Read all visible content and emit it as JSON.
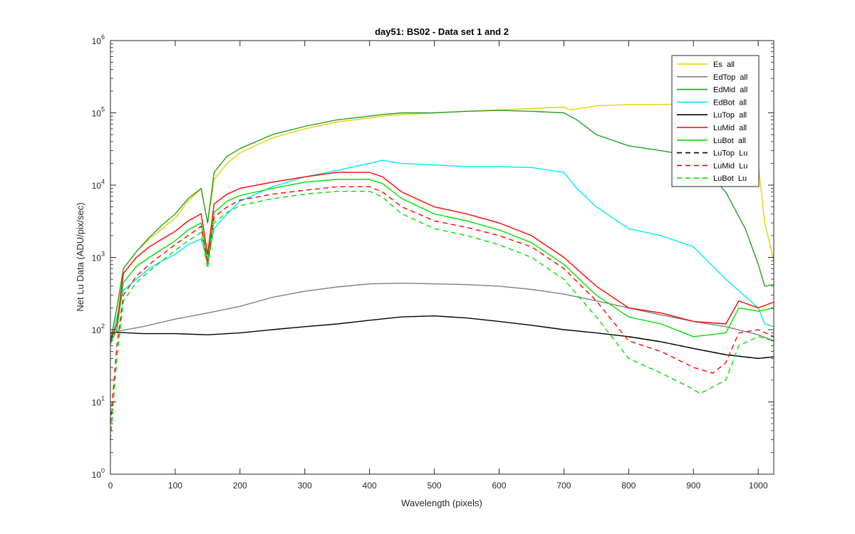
{
  "chart_data": {
    "type": "line",
    "title": "day51: BS02 - Data set 1 and 2",
    "xlabel": "Wavelength (pixels)",
    "ylabel": "Net Lu Data (ADU/pix/sec)",
    "xlim": [
      0,
      1024
    ],
    "ylim": [
      1,
      1000000
    ],
    "yscale": "log",
    "grid": false,
    "legend_position": "top-right",
    "x_ticks": [
      0,
      100,
      200,
      300,
      400,
      500,
      600,
      700,
      800,
      900,
      1000
    ],
    "y_ticks": [
      {
        "base": "10",
        "exp": "0",
        "value": 1
      },
      {
        "base": "10",
        "exp": "1",
        "value": 10
      },
      {
        "base": "10",
        "exp": "2",
        "value": 100
      },
      {
        "base": "10",
        "exp": "3",
        "value": 1000
      },
      {
        "base": "10",
        "exp": "4",
        "value": 10000
      },
      {
        "base": "10",
        "exp": "5",
        "value": 100000
      },
      {
        "base": "10",
        "exp": "6",
        "value": 1000000
      }
    ],
    "series": [
      {
        "name": "Es  all",
        "color": "#e6d000",
        "dash": "solid",
        "x": [
          0,
          10,
          20,
          40,
          60,
          80,
          100,
          120,
          140,
          150,
          160,
          180,
          200,
          250,
          300,
          350,
          400,
          420,
          450,
          500,
          550,
          600,
          650,
          700,
          710,
          750,
          800,
          850,
          900,
          950,
          980,
          1000,
          1010,
          1024
        ],
        "y": [
          70,
          200,
          700,
          1200,
          1800,
          2500,
          3500,
          6000,
          9000,
          3000,
          12000,
          20000,
          28000,
          45000,
          60000,
          75000,
          85000,
          90000,
          95000,
          100000,
          105000,
          110000,
          115000,
          120000,
          110000,
          125000,
          130000,
          130000,
          135000,
          130000,
          100000,
          20000,
          3000,
          900
        ]
      },
      {
        "name": "EdTop  all",
        "color": "#808080",
        "dash": "solid",
        "x": [
          0,
          10,
          50,
          100,
          150,
          200,
          250,
          300,
          350,
          400,
          450,
          500,
          550,
          600,
          650,
          700,
          750,
          800,
          850,
          900,
          950,
          1000,
          1024
        ],
        "y": [
          80,
          95,
          110,
          140,
          170,
          210,
          280,
          340,
          390,
          430,
          440,
          430,
          420,
          400,
          360,
          310,
          250,
          200,
          160,
          130,
          110,
          85,
          70
        ]
      },
      {
        "name": "EdMid  all",
        "color": "#20a020",
        "dash": "solid",
        "x": [
          0,
          10,
          20,
          40,
          60,
          80,
          100,
          120,
          140,
          150,
          160,
          180,
          200,
          250,
          300,
          350,
          400,
          420,
          450,
          500,
          550,
          600,
          650,
          700,
          720,
          750,
          800,
          850,
          900,
          950,
          980,
          1000,
          1010,
          1024
        ],
        "y": [
          70,
          200,
          700,
          1200,
          1900,
          2800,
          4000,
          6500,
          9000,
          3000,
          15000,
          25000,
          32000,
          50000,
          65000,
          80000,
          90000,
          95000,
          100000,
          100000,
          105000,
          108000,
          105000,
          100000,
          80000,
          50000,
          35000,
          30000,
          25000,
          8000,
          2500,
          800,
          400,
          420
        ]
      },
      {
        "name": "EdBot  all",
        "color": "#00e5ff",
        "dash": "solid",
        "x": [
          0,
          10,
          20,
          40,
          60,
          80,
          100,
          120,
          140,
          150,
          160,
          180,
          200,
          250,
          300,
          350,
          400,
          420,
          450,
          500,
          550,
          600,
          650,
          700,
          720,
          750,
          800,
          850,
          900,
          950,
          1000,
          1010,
          1024
        ],
        "y": [
          60,
          150,
          350,
          500,
          700,
          900,
          1100,
          1500,
          1800,
          900,
          2500,
          4000,
          6000,
          9500,
          13000,
          16000,
          20000,
          22000,
          20000,
          19000,
          18000,
          18000,
          17500,
          15000,
          9000,
          5000,
          2500,
          2000,
          1400,
          500,
          200,
          120,
          110
        ]
      },
      {
        "name": "LuTop  all",
        "color": "#000000",
        "dash": "solid",
        "x": [
          0,
          10,
          50,
          100,
          150,
          200,
          250,
          300,
          350,
          400,
          450,
          500,
          550,
          600,
          650,
          700,
          750,
          800,
          850,
          900,
          950,
          1000,
          1024
        ],
        "y": [
          90,
          92,
          88,
          88,
          85,
          90,
          100,
          110,
          120,
          135,
          150,
          155,
          145,
          130,
          115,
          100,
          90,
          80,
          68,
          55,
          45,
          40,
          42
        ]
      },
      {
        "name": "LuMid  all",
        "color": "#ff0000",
        "dash": "solid",
        "x": [
          0,
          10,
          20,
          40,
          60,
          80,
          100,
          120,
          140,
          150,
          160,
          180,
          200,
          250,
          300,
          350,
          400,
          420,
          450,
          500,
          550,
          600,
          650,
          700,
          750,
          800,
          850,
          900,
          950,
          970,
          1000,
          1024
        ],
        "y": [
          70,
          120,
          600,
          1000,
          1400,
          1800,
          2300,
          3200,
          4000,
          1100,
          5500,
          7500,
          9000,
          11000,
          13000,
          15000,
          15000,
          13000,
          8000,
          5000,
          4000,
          3000,
          2000,
          1000,
          400,
          200,
          170,
          130,
          120,
          250,
          200,
          240
        ]
      },
      {
        "name": "LuBot  all",
        "color": "#00e000",
        "dash": "solid",
        "x": [
          0,
          10,
          20,
          40,
          60,
          80,
          100,
          120,
          140,
          150,
          160,
          180,
          200,
          250,
          300,
          350,
          400,
          420,
          450,
          500,
          550,
          600,
          650,
          700,
          750,
          800,
          850,
          900,
          950,
          970,
          1000,
          1024
        ],
        "y": [
          65,
          100,
          450,
          750,
          1000,
          1300,
          1700,
          2400,
          3000,
          900,
          4200,
          6000,
          7200,
          9000,
          11000,
          12000,
          12000,
          10500,
          6500,
          4000,
          3200,
          2400,
          1600,
          800,
          300,
          150,
          120,
          80,
          90,
          200,
          180,
          200
        ]
      },
      {
        "name": "LuTop  Lu",
        "color": "#000000",
        "dash": "dashed",
        "x": [
          800,
          850,
          900,
          950,
          1000,
          1024
        ],
        "y": [
          80,
          68,
          55,
          45,
          40,
          42
        ]
      },
      {
        "name": "LuMid  Lu",
        "color": "#ff0000",
        "dash": "dashed",
        "x": [
          0,
          10,
          20,
          40,
          60,
          80,
          100,
          120,
          140,
          150,
          160,
          180,
          200,
          250,
          300,
          350,
          400,
          420,
          450,
          500,
          550,
          600,
          650,
          700,
          750,
          800,
          850,
          900,
          930,
          950,
          970,
          1000,
          1024
        ],
        "y": [
          5,
          60,
          300,
          550,
          800,
          1100,
          1500,
          2000,
          2700,
          800,
          3600,
          5000,
          6200,
          7500,
          8500,
          9500,
          9500,
          8000,
          5000,
          3200,
          2600,
          2000,
          1400,
          700,
          250,
          70,
          50,
          30,
          25,
          35,
          90,
          100,
          80
        ]
      },
      {
        "name": "LuBot  Lu",
        "color": "#00e000",
        "dash": "dashed",
        "x": [
          0,
          10,
          20,
          40,
          60,
          80,
          100,
          120,
          140,
          150,
          160,
          180,
          200,
          250,
          300,
          350,
          400,
          420,
          450,
          500,
          550,
          600,
          650,
          700,
          750,
          800,
          850,
          900,
          910,
          950,
          970,
          1000,
          1024
        ],
        "y": [
          3,
          40,
          250,
          450,
          650,
          900,
          1250,
          1700,
          2200,
          700,
          3000,
          4200,
          5200,
          6500,
          7500,
          8200,
          8200,
          6800,
          4000,
          2500,
          2000,
          1500,
          1000,
          500,
          150,
          40,
          25,
          15,
          13,
          20,
          60,
          80,
          70
        ]
      }
    ]
  }
}
